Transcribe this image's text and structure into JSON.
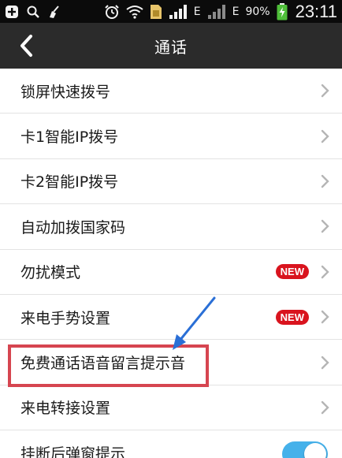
{
  "status_bar": {
    "battery_percent": "90%",
    "time": "23:11",
    "icons": [
      "plus-box-icon",
      "search-icon",
      "broom-icon",
      "alarm-icon",
      "wifi-icon",
      "sim-card-icon",
      "signal-icon",
      "e-network-icon",
      "signal-icon",
      "e-network-icon",
      "battery-charging-icon"
    ],
    "e_label": "E"
  },
  "header": {
    "title": "通话"
  },
  "settings": {
    "items": [
      {
        "label": "锁屏快速拨号"
      },
      {
        "label": "卡1智能IP拨号"
      },
      {
        "label": "卡2智能IP拨号"
      },
      {
        "label": "自动加拨国家码"
      },
      {
        "label": "勿扰模式",
        "badge": "NEW"
      },
      {
        "label": "来电手势设置",
        "badge": "NEW"
      },
      {
        "label": "免费通话语音留言提示音"
      },
      {
        "label": "来电转接设置"
      },
      {
        "label": "挂断后弹窗提示",
        "toggle_on": true
      }
    ]
  },
  "colors": {
    "status_bg": "#0b0b0b",
    "title_bg": "#2b2b2b",
    "badge": "#d9141e",
    "highlight": "#d64550",
    "arrow": "#2a6fd6",
    "toggle": "#45b1ea"
  }
}
